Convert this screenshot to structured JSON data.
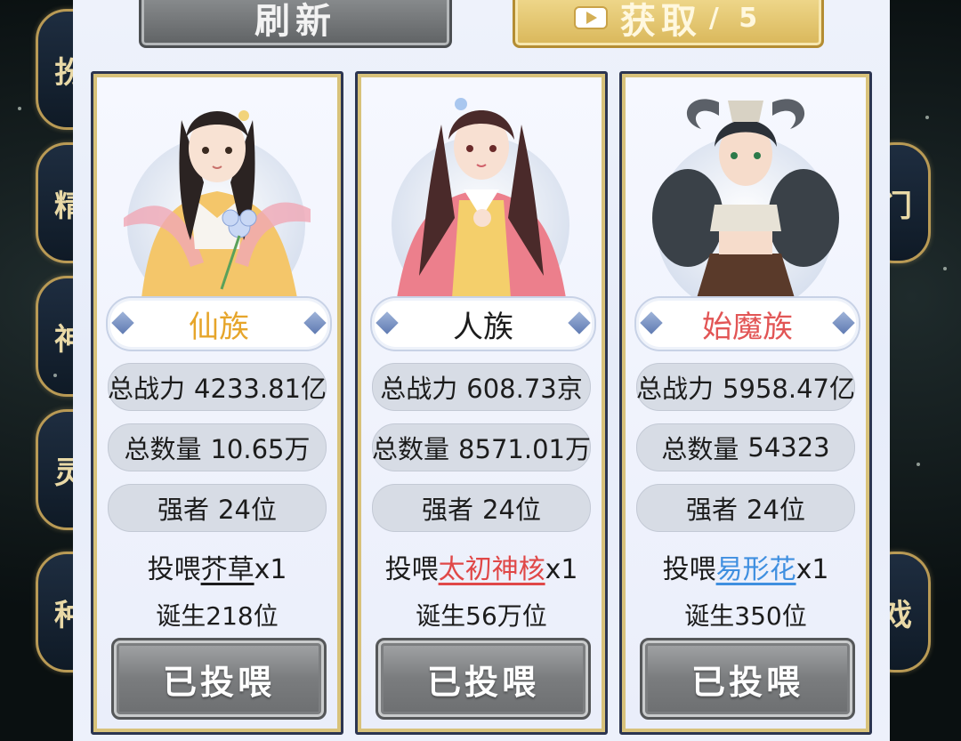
{
  "top_buttons": {
    "refresh_label": "刷新",
    "obtain_label": "获取",
    "obtain_suffix": "/ 5",
    "obtain_icon": "video-play-icon"
  },
  "side_labels_left": [
    "扮",
    "精",
    "神",
    "灵",
    "种"
  ],
  "side_labels_right": [
    "门",
    "戏"
  ],
  "cards": [
    {
      "race": "仙族",
      "race_color": "#e6a52a",
      "power_label": "总战力",
      "power_value": "4233.81亿",
      "count_label": "总数量",
      "count_value": "10.65万",
      "strong_label": "强者",
      "strong_value": "24位",
      "feed_prefix": "投喂",
      "feed_item": "芥草",
      "feed_item_color": "#1c1c1c",
      "feed_qty": "x1",
      "born_text": "诞生218位",
      "button_label": "已投喂"
    },
    {
      "race": "人族",
      "race_color": "#1c1c1c",
      "power_label": "总战力",
      "power_value": "608.73京",
      "count_label": "总数量",
      "count_value": "8571.01万",
      "strong_label": "强者",
      "strong_value": "24位",
      "feed_prefix": "投喂",
      "feed_item": "太初神核",
      "feed_item_color": "#e04848",
      "feed_qty": "x1",
      "born_text": "诞生56万位",
      "button_label": "已投喂"
    },
    {
      "race": "始魔族",
      "race_color": "#e25555",
      "power_label": "总战力",
      "power_value": "5958.47亿",
      "count_label": "总数量",
      "count_value": "54323",
      "strong_label": "强者",
      "strong_value": "24位",
      "feed_prefix": "投喂",
      "feed_item": "易形花",
      "feed_item_color": "#3f8fe0",
      "feed_qty": "x1",
      "born_text": "诞生350位",
      "button_label": "已投喂"
    }
  ]
}
